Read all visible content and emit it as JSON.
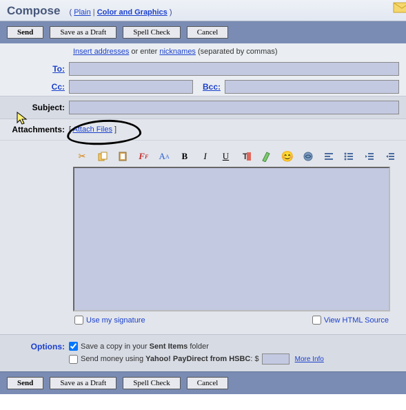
{
  "header": {
    "title": "Compose",
    "lparen": "( ",
    "plain_link": "Plain",
    "sep": " | ",
    "color_link": "Color and Graphics",
    "rparen": " )"
  },
  "buttons": {
    "send": "Send",
    "save_draft": "Save as a Draft",
    "spell_check": "Spell Check",
    "cancel": "Cancel"
  },
  "hint": {
    "insert_addr": "Insert addresses",
    "mid": " or enter ",
    "nicknames": "nicknames",
    "after": " (separated by commas)"
  },
  "labels": {
    "to": "To:",
    "cc": "Cc:",
    "bcc": "Bcc:",
    "subject": "Subject:",
    "attachments": "Attachments:",
    "options": "Options:"
  },
  "attach": {
    "lb": "[ ",
    "link": "Attach Files",
    "rb": " ]"
  },
  "checks": {
    "use_sig": "Use my signature",
    "view_html": "View HTML Source",
    "save_copy_pre": "Save a copy in your ",
    "save_copy_bold": "Sent Items",
    "save_copy_post": " folder",
    "send_money_pre": "Send money using ",
    "send_money_bold": "Yahoo! PayDirect from HSBC",
    "send_money_post": ": $",
    "more_info": "More Info"
  },
  "fields": {
    "to": "",
    "cc": "",
    "bcc": "",
    "subject": "",
    "body": "",
    "amount": ""
  },
  "toolbar_icons": [
    "cut",
    "copy",
    "paste",
    "format-remove",
    "font-style",
    "bold",
    "italic",
    "underline",
    "font-color",
    "highlight",
    "emoticon",
    "insert-image",
    "align",
    "list",
    "outdent",
    "indent"
  ]
}
